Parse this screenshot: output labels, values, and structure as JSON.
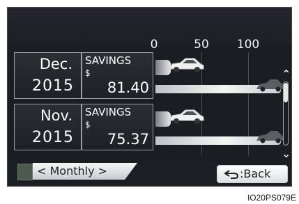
{
  "scale": {
    "ticks": [
      "0",
      "50",
      "100"
    ]
  },
  "rows": [
    {
      "month": "Dec.",
      "year": "2015",
      "savings_label": "SAVINGS",
      "currency": "$",
      "amount": "81.40"
    },
    {
      "month": "Nov.",
      "year": "2015",
      "savings_label": "SAVINGS",
      "currency": "$",
      "amount": "75.37"
    }
  ],
  "controls": {
    "monthly_label": "< Monthly >",
    "back_label": ":Back"
  },
  "figure_code": "IO20PS079E"
}
